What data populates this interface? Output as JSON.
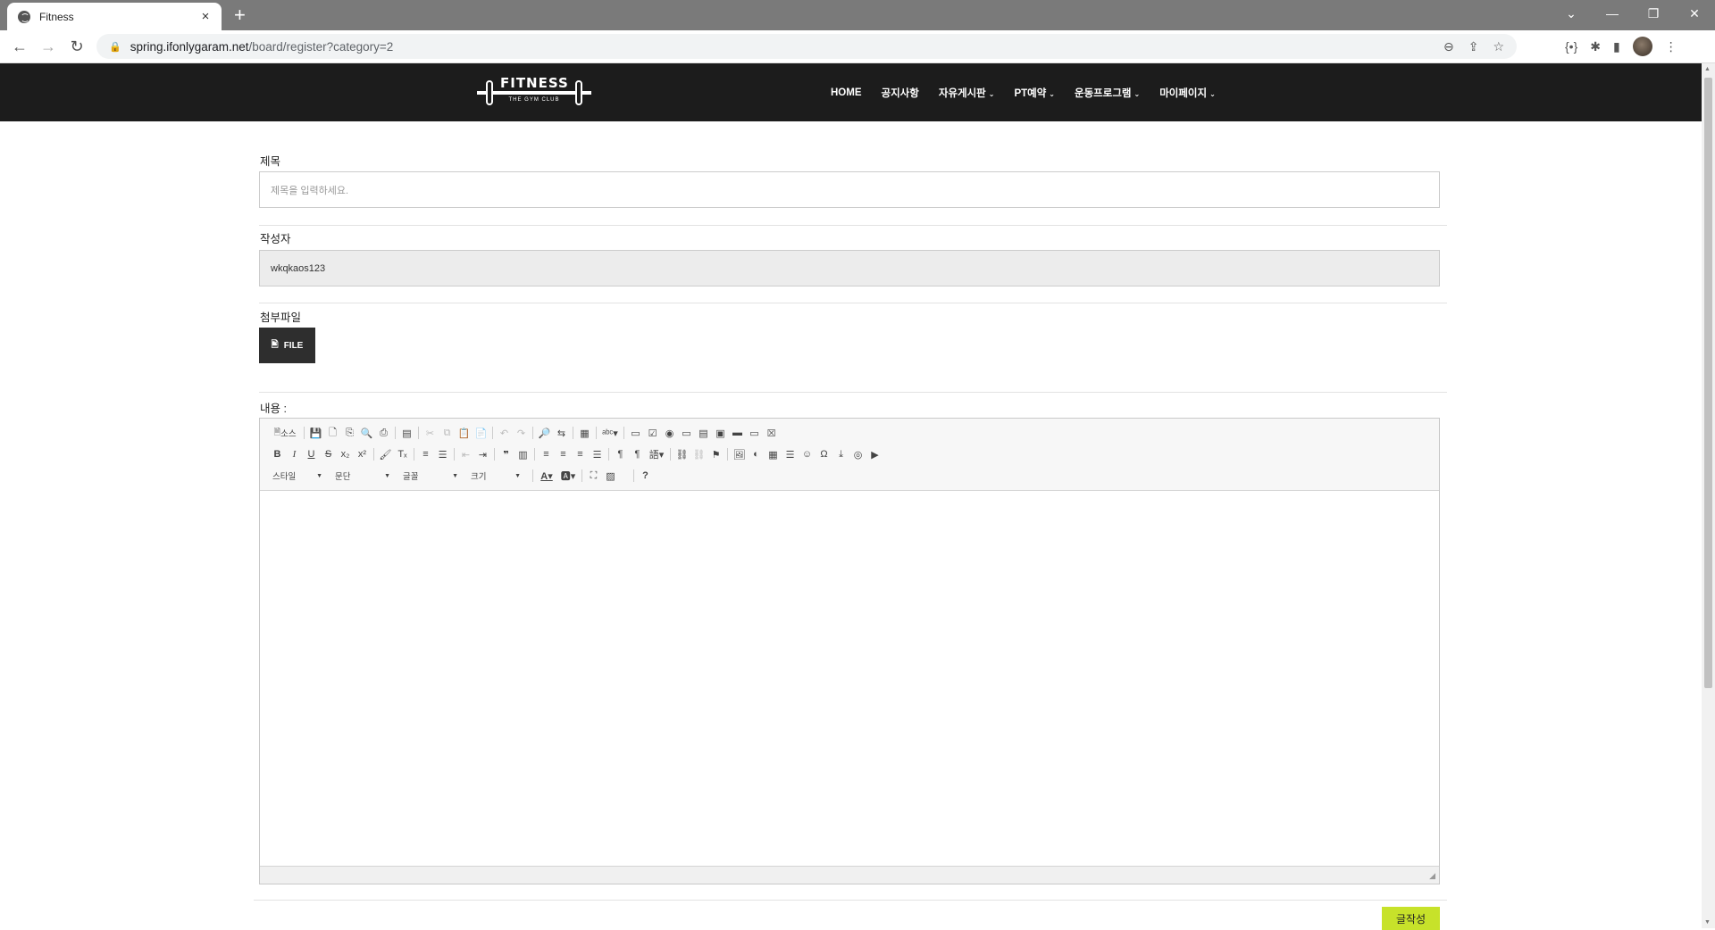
{
  "browser": {
    "tab_title": "Fitness",
    "url_host": "spring.ifonlygaram.net",
    "url_path": "/board/register?category=2"
  },
  "site": {
    "logo_text": "FITNESS",
    "logo_sub": "THE GYM CLUB",
    "nav": [
      {
        "label": "HOME",
        "dropdown": false
      },
      {
        "label": "공지사항",
        "dropdown": false
      },
      {
        "label": "자유게시판",
        "dropdown": true
      },
      {
        "label": "PT예약",
        "dropdown": true
      },
      {
        "label": "운동프로그램",
        "dropdown": true
      },
      {
        "label": "마이페이지",
        "dropdown": true
      }
    ]
  },
  "form": {
    "title_label": "제목",
    "title_placeholder": "제목을 입력하세요.",
    "writer_label": "작성자",
    "writer_value": "wkqkaos123",
    "file_label": "첨부파일",
    "file_button": "FILE",
    "content_label": "내용 :",
    "submit_label": "글작성"
  },
  "editor": {
    "source_label": "소스",
    "style_combo": "스타일",
    "format_combo": "문단",
    "font_combo": "글꼴",
    "size_combo": "크기"
  }
}
